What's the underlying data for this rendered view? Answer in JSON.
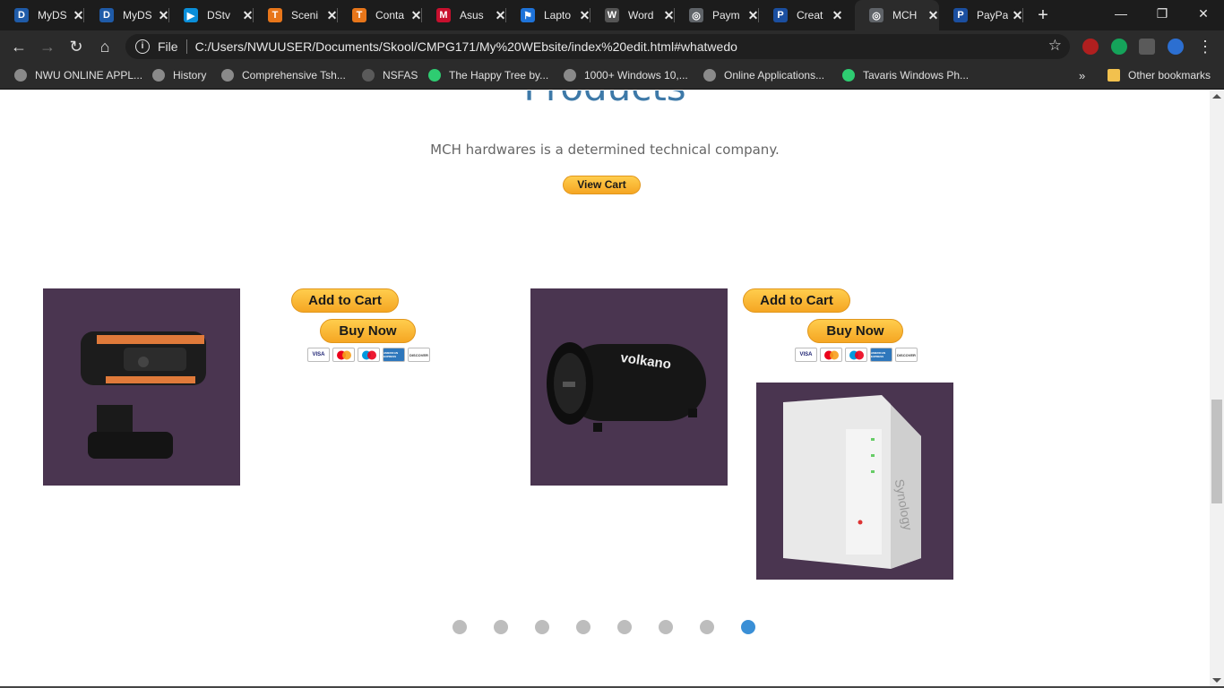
{
  "tabs": [
    {
      "title": "MyDS",
      "icon": "myds-icon",
      "color": "#1f5ba8",
      "glyph": "D"
    },
    {
      "title": "MyDS",
      "icon": "myds-icon",
      "color": "#1f5ba8",
      "glyph": "D"
    },
    {
      "title": "DStv",
      "icon": "dstv-play-icon",
      "color": "#0a8ed9",
      "glyph": "▶"
    },
    {
      "title": "Sceni",
      "icon": "t-icon",
      "color": "#e8761a",
      "glyph": "T"
    },
    {
      "title": "Conta",
      "icon": "t-icon",
      "color": "#e8761a",
      "glyph": "T"
    },
    {
      "title": "Asus",
      "icon": "mcafee-icon",
      "color": "#c8102e",
      "glyph": "M"
    },
    {
      "title": "Lapto",
      "icon": "flag-icon",
      "color": "#1e73d9",
      "glyph": "⚑"
    },
    {
      "title": "Word",
      "icon": "wordpress-icon",
      "color": "#555555",
      "glyph": "W"
    },
    {
      "title": "Paym",
      "icon": "globe-icon",
      "color": "#5f6368",
      "glyph": "◎"
    },
    {
      "title": "Creat",
      "icon": "paypal-icon",
      "color": "#1b4fa0",
      "glyph": "P"
    },
    {
      "title": "MCH",
      "icon": "globe-icon",
      "color": "#5f6368",
      "glyph": "◎"
    },
    {
      "title": "PayPa",
      "icon": "paypal-icon",
      "color": "#1b4fa0",
      "glyph": "P"
    }
  ],
  "active_tab_index": 10,
  "address": {
    "file_label": "File",
    "url": "C:/Users/NWUUSER/Documents/Skool/CMPG171/My%20WEbsite/index%20edit.html#whatwedo"
  },
  "bookmarks": [
    {
      "label": "NWU ONLINE APPL...",
      "icon": "globe-icon"
    },
    {
      "label": "History",
      "icon": "history-icon"
    },
    {
      "label": "Comprehensive Tsh...",
      "icon": "globe-icon"
    },
    {
      "label": "NSFAS",
      "icon": "nsfas-icon"
    },
    {
      "label": "The Happy Tree by...",
      "icon": "tree-icon"
    },
    {
      "label": "1000+ Windows 10,...",
      "icon": "globe-icon"
    },
    {
      "label": "Online Applications...",
      "icon": "globe-icon"
    },
    {
      "label": "Tavaris Windows Ph...",
      "icon": "tree-icon"
    }
  ],
  "other_bookmarks": "Other bookmarks",
  "overflow_chevron": "»",
  "page": {
    "heading": "Products",
    "tagline": "MCH hardwares is a determined technical company.",
    "view_cart": "View Cart",
    "add_to_cart": "Add to Cart",
    "buy_now": "Buy Now",
    "products": [
      {
        "name": "webcam"
      },
      {
        "name": "volkano bluetooth speaker",
        "brand_text": "volkano"
      },
      {
        "name": "synology nas",
        "brand_text": "Synology"
      }
    ],
    "card_logos": [
      "VISA",
      "mastercard",
      "maestro",
      "AMERICAN EXPRESS",
      "DISCOVER"
    ],
    "carousel_dots": 8,
    "carousel_active": 7
  },
  "colors": {
    "heading": "#3d79a8",
    "product_bg": "#4a3550",
    "paypal_gold": "#ffc439",
    "dot_active": "#3a8fd6"
  }
}
